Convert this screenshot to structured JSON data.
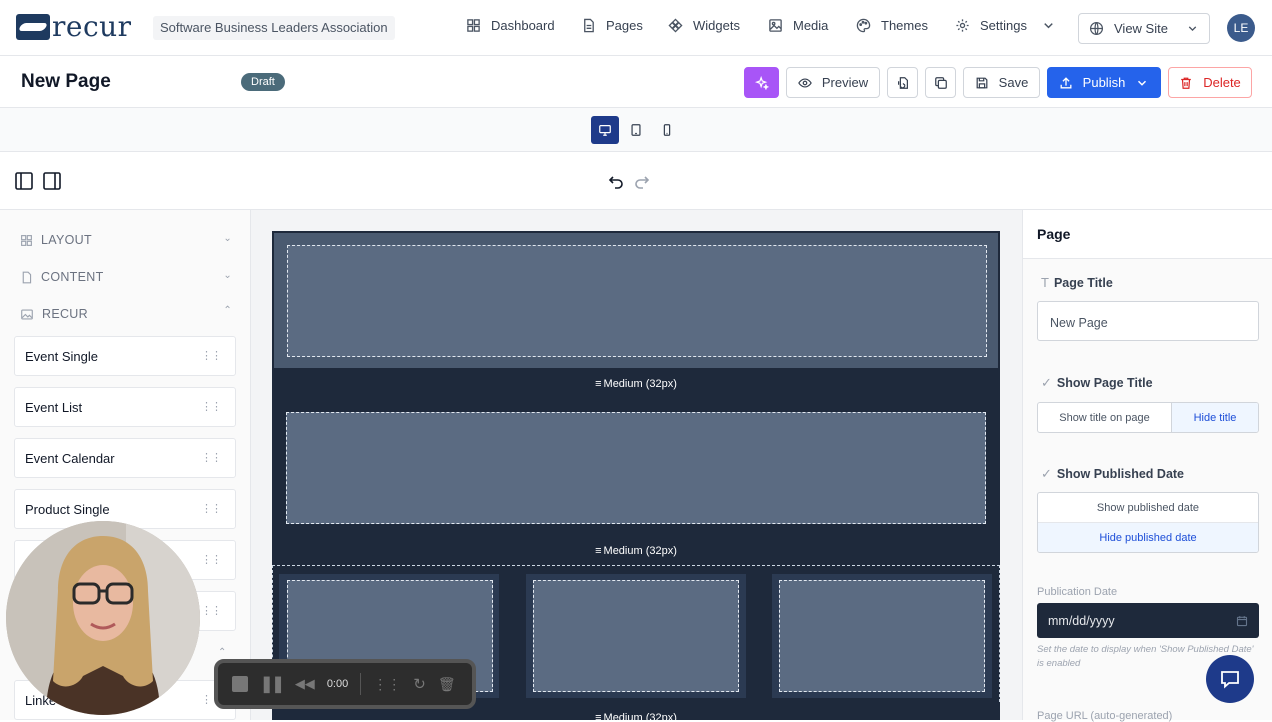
{
  "brand": {
    "logo_text": "recur",
    "org_name": "Software Business Leaders Association"
  },
  "nav": {
    "dashboard": "Dashboard",
    "pages": "Pages",
    "widgets": "Widgets",
    "media": "Media",
    "themes": "Themes",
    "settings": "Settings",
    "view_site": "View Site",
    "avatar_initials": "LE"
  },
  "page": {
    "title": "New Page",
    "status": "Draft",
    "buttons": {
      "preview": "Preview",
      "save": "Save",
      "publish": "Publish",
      "delete": "Delete"
    }
  },
  "left_panel": {
    "sections": [
      {
        "label": "LAYOUT",
        "icon": "grid-icon",
        "expanded": false
      },
      {
        "label": "CONTENT",
        "icon": "document-icon",
        "expanded": false
      },
      {
        "label": "RECUR",
        "icon": "image-icon",
        "expanded": true
      }
    ],
    "widgets": [
      "Event Single",
      "Event List",
      "Event Calendar",
      "Product Single",
      "Linke"
    ]
  },
  "canvas": {
    "spacer_label": "Medium (32px)"
  },
  "right_panel": {
    "heading": "Page",
    "page_title_label": "Page Title",
    "page_title_value": "New Page",
    "show_page_title_label": "Show Page Title",
    "show_title_option": "Show title on page",
    "hide_title_option": "Hide title",
    "show_published_date_label": "Show Published Date",
    "show_date_option": "Show published date",
    "hide_date_option": "Hide published date",
    "publication_date_label": "Publication Date",
    "publication_date_placeholder": "mm/dd/yyyy",
    "publication_date_help": "Set the date to display when 'Show Published Date' is enabled",
    "page_url_label": "Page URL (auto-generated)"
  },
  "recorder": {
    "time": "0:00"
  },
  "colors": {
    "primary": "#2563eb",
    "ai": "#a855f7",
    "danger": "#dc2626",
    "canvas_block": "#1e293b",
    "draft": "#4b6b7a"
  }
}
